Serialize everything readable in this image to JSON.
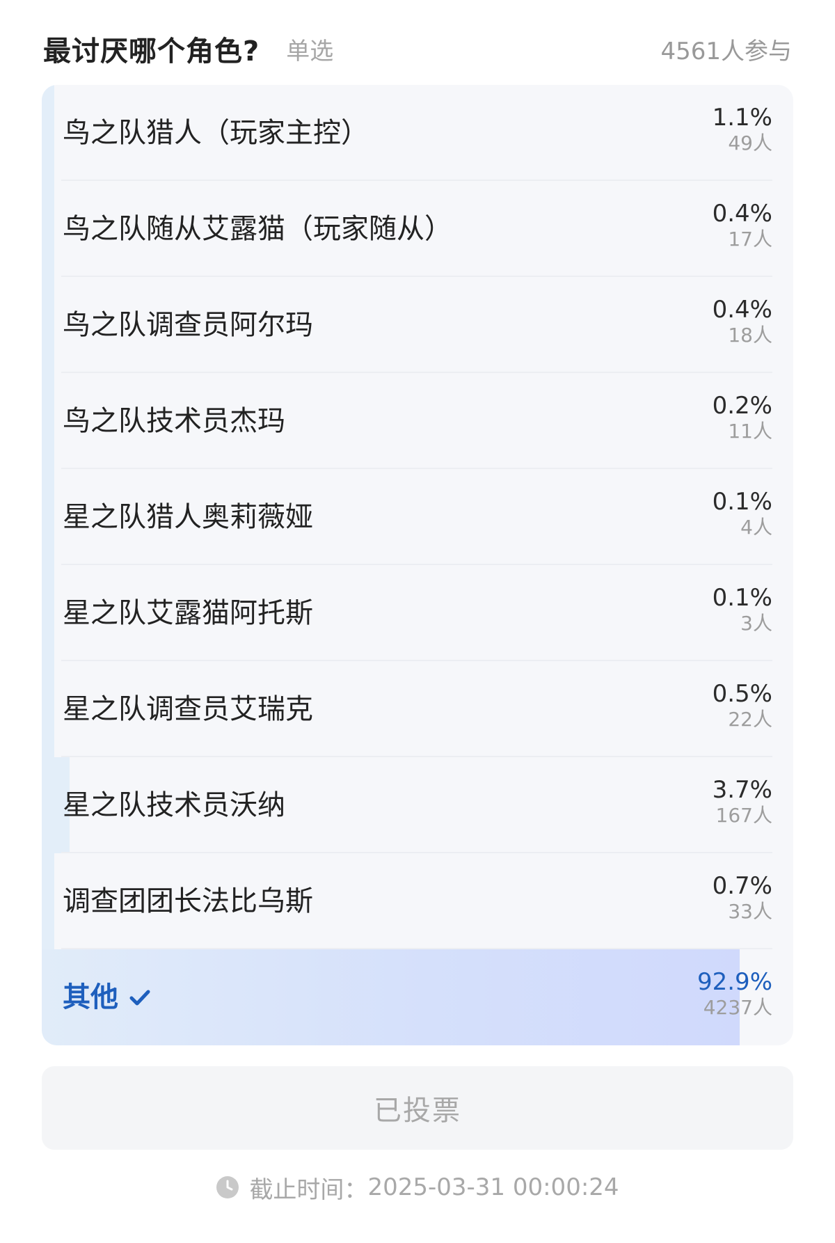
{
  "poll": {
    "title": "最讨厌哪个角色?",
    "type_label": "单选",
    "participants": "4561人参与",
    "options": [
      {
        "label": "鸟之队猎人（玩家主控）",
        "percent": "1.1%",
        "votes": "49人",
        "share": 0.011
      },
      {
        "label": "鸟之队随从艾露猫（玩家随从）",
        "percent": "0.4%",
        "votes": "17人",
        "share": 0.004
      },
      {
        "label": "鸟之队调查员阿尔玛",
        "percent": "0.4%",
        "votes": "18人",
        "share": 0.004
      },
      {
        "label": "鸟之队技术员杰玛",
        "percent": "0.2%",
        "votes": "11人",
        "share": 0.002
      },
      {
        "label": "星之队猎人奥莉薇娅",
        "percent": "0.1%",
        "votes": "4人",
        "share": 0.001
      },
      {
        "label": "星之队艾露猫阿托斯",
        "percent": "0.1%",
        "votes": "3人",
        "share": 0.001
      },
      {
        "label": "星之队调查员艾瑞克",
        "percent": "0.5%",
        "votes": "22人",
        "share": 0.005
      },
      {
        "label": "星之队技术员沃纳",
        "percent": "3.7%",
        "votes": "167人",
        "share": 0.037
      },
      {
        "label": "调查团团长法比乌斯",
        "percent": "0.7%",
        "votes": "33人",
        "share": 0.007
      },
      {
        "label": "其他",
        "percent": "92.9%",
        "votes": "4237人",
        "share": 0.929,
        "selected": true
      }
    ],
    "vote_button_label": "已投票",
    "deadline_label": "截止时间：",
    "deadline_value": "2025-03-31 00:00:24"
  },
  "colors": {
    "accent": "#1e5fbd",
    "bar_fill": "#e3eef9",
    "panel_bg": "#f6f7fa",
    "muted_text": "#a8a8a8"
  },
  "icons": {
    "selected_marker": "check-icon",
    "deadline": "clock-icon"
  }
}
